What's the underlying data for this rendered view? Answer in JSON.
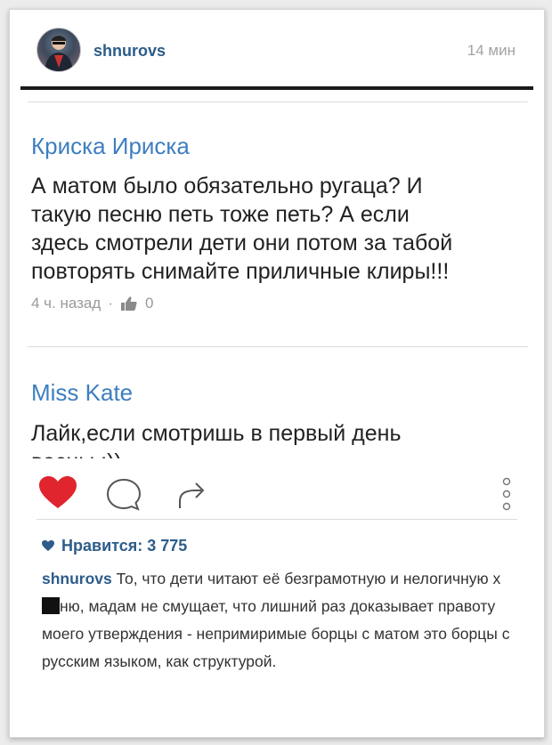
{
  "post": {
    "username": "shnurovs",
    "time": "14 мин"
  },
  "comments": [
    {
      "author": "Криска Ириска",
      "lines": [
        "А матом было обязательно ругаца? И",
        "такую песню петь тоже петь? А если",
        "здесь смотрели дети они потом за  табой",
        "повторять снимайте приличные клиры!!!"
      ],
      "time": "4 ч. назад",
      "separator": "·",
      "likes": "0"
    },
    {
      "author": "Miss Kate",
      "lines": [
        "Лайк,если смотришь в первый день",
        "весны :))"
      ]
    }
  ],
  "likes": {
    "text": "Нравится: 3 775"
  },
  "caption": {
    "user": "shnurovs",
    "part1": "То, что дети читают её безграмотную и нелогичную х",
    "part2": "ню, мадам не смущает, что лишний раз доказывает правоту моего утверждения - непримиримые борцы с матом это борцы с русским языком, как структурой."
  },
  "colors": {
    "username": "#2d5c8a",
    "comment_author": "#3e7ec0",
    "heart": "#e0252f"
  },
  "icons": [
    "heart-icon",
    "comment-icon",
    "share-icon",
    "more-options-icon",
    "thumbs-up-icon",
    "small-heart-icon"
  ]
}
